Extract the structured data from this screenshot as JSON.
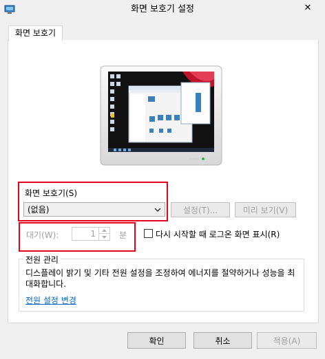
{
  "window": {
    "title": "화면 보호기 설정",
    "close_symbol": "✕"
  },
  "tabs": [
    {
      "label": "화면 보호기"
    }
  ],
  "screensaver": {
    "group_label": "화면 보호기(S)",
    "selected": "(없음)",
    "settings_button": "설정(T)...",
    "preview_button": "미리 보기(V)"
  },
  "wait": {
    "label": "대기(W):",
    "value": "1",
    "unit": "분",
    "resume_label": "다시 시작할 때 로그온 화면 표시(R)",
    "resume_checked": false
  },
  "power": {
    "group_label": "전원 관리",
    "description": "디스플레이 밝기 및 기타 전원 설정을 조정하여 에너지를 절약하거나 성능을 최대화합니다.",
    "link": "전원 설정 변경"
  },
  "footer": {
    "ok": "확인",
    "cancel": "취소",
    "apply": "적용(A)"
  },
  "colors": {
    "highlight_box": "#e3001b",
    "link": "#0066cc"
  }
}
